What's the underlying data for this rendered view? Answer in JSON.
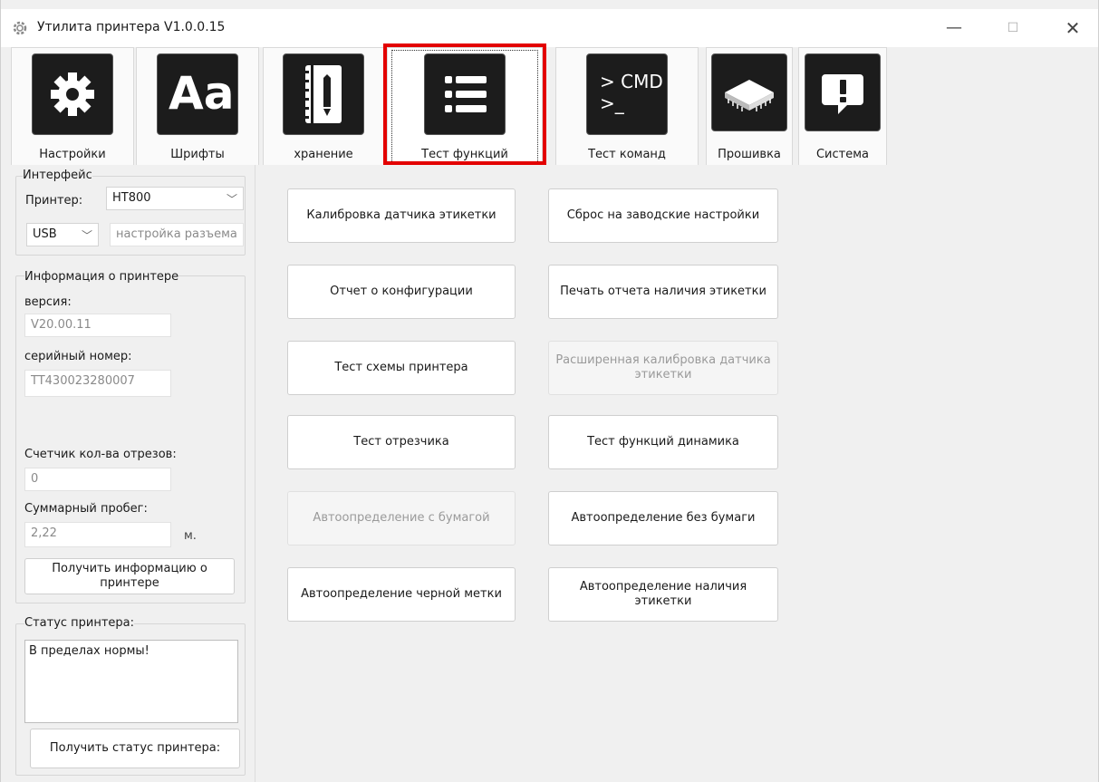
{
  "window": {
    "title": "Утилита принтера  V1.0.0.15",
    "minimize": "—",
    "maximize": "☐",
    "close": "✕"
  },
  "toolbar": {
    "tabs": [
      {
        "label": "Настройки",
        "icon": "gear-icon"
      },
      {
        "label": "Шрифты",
        "icon": "font-icon",
        "icon_text": "Aa"
      },
      {
        "label": "хранение",
        "icon": "notebook-icon"
      },
      {
        "label": "Тест функций",
        "icon": "list-icon",
        "active": true
      },
      {
        "label": "Тест команд",
        "icon": "cmd-icon",
        "icon_text_1": "> CMD",
        "icon_text_2": ">_"
      },
      {
        "label": "Прошивка",
        "icon": "chip-icon"
      },
      {
        "label": "Система",
        "icon": "alert-icon"
      }
    ],
    "highlight_color": "#e30000"
  },
  "interface": {
    "group_label": "Интерфейс",
    "printer_label": "Принтер:",
    "printer_value": "HT800",
    "port_value": "USB",
    "port_settings_placeholder": "настройка разъема"
  },
  "printer_info": {
    "group_label": "Информация о принтере",
    "version_label": "версия:",
    "version_value": "V20.00.11",
    "serial_label": "серийный номер:",
    "serial_value": "TT430023280007",
    "cut_counter_label": "Счетчик кол-ва отрезов:",
    "cut_counter_value": "0",
    "mileage_label": "Суммарный пробег:",
    "mileage_value": "2,22",
    "mileage_unit": "м.",
    "get_info_button": "Получить информацию о принтере"
  },
  "status": {
    "group_label": "Статус принтера:",
    "status_text": "В пределах нормы!",
    "get_status_button": "Получить статус принтера:"
  },
  "functions": {
    "left": [
      {
        "label": "Калибровка датчика этикетки",
        "enabled": true
      },
      {
        "label": "Отчет о конфигурации",
        "enabled": true
      },
      {
        "label": "Тест схемы принтера",
        "enabled": true
      },
      {
        "label": "Тест отрезчика",
        "enabled": true
      },
      {
        "label": "Автоопределение с бумагой",
        "enabled": false
      },
      {
        "label": "Автоопределение черной метки",
        "enabled": true
      }
    ],
    "right": [
      {
        "label": "Сброс на заводские настройки",
        "enabled": true
      },
      {
        "label": "Печать отчета наличия этикетки",
        "enabled": true
      },
      {
        "label": "Расширенная калибровка датчика этикетки",
        "enabled": false
      },
      {
        "label": "Тест функций динамика",
        "enabled": true
      },
      {
        "label": "Автоопределение без бумаги",
        "enabled": true
      },
      {
        "label": "Автоопределение наличия этикетки",
        "enabled": true
      }
    ]
  }
}
